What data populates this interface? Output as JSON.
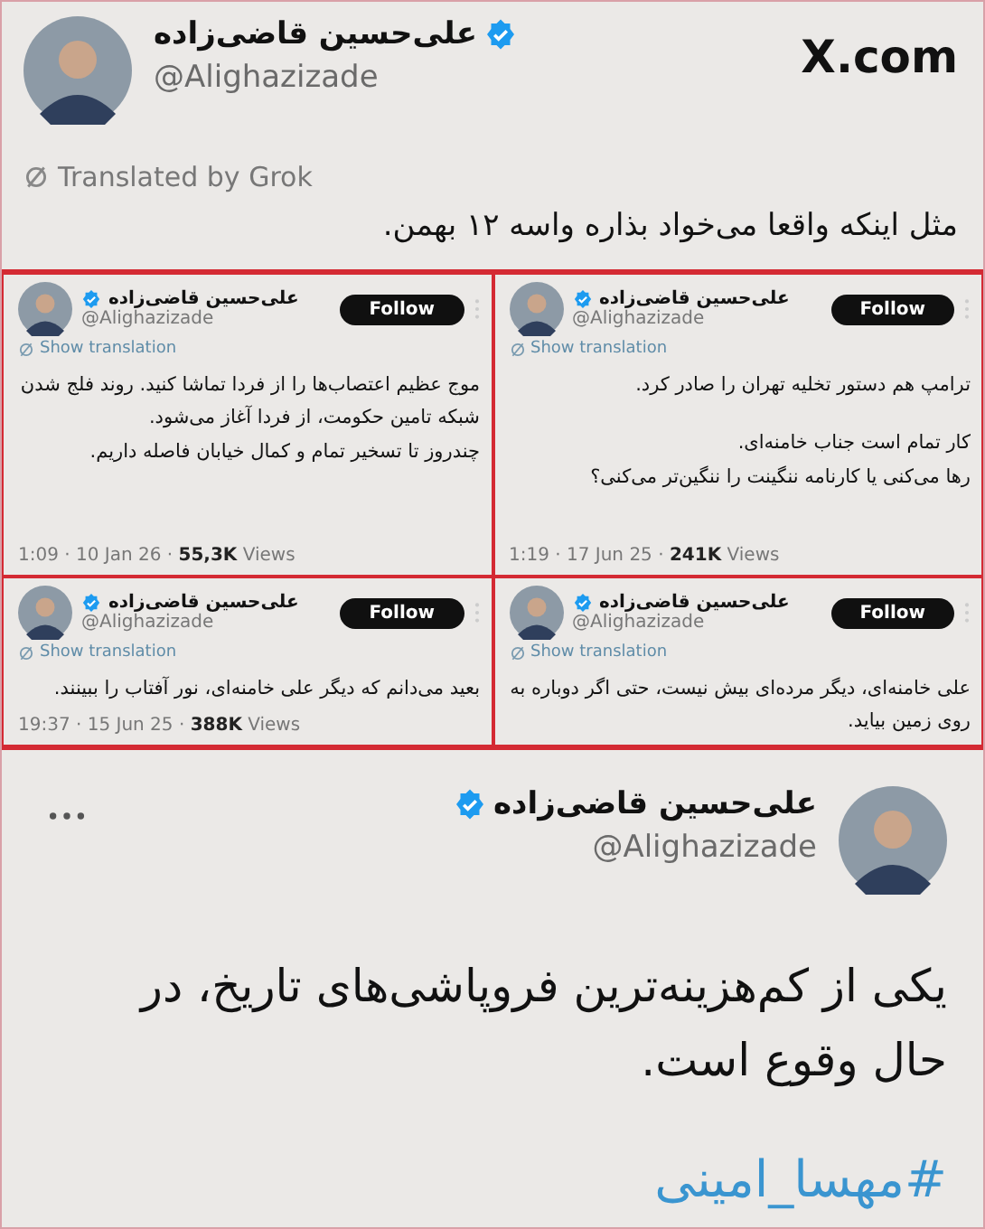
{
  "top_post": {
    "name": "علی‌حسین قاضی‌زاده",
    "verified": true,
    "handle": "@Alighazizade",
    "site": "X.com",
    "translated_by": "Translated by Grok",
    "text": "مثل اینکه واقعا می‌خواد بذاره واسه ۱۲ بهمن."
  },
  "grid_posts": [
    {
      "name": "علی‌حسین قاضی‌زاده",
      "verified": true,
      "handle": "@Alighazizade",
      "follow": "Follow",
      "show_translation": "Show translation",
      "paragraphs": [
        "ترامپ هم دستور تخلیه تهران را صادر کرد.",
        "کار تمام است جناب خامنه‌ای.\nرها می‌کنی یا کارنامه ننگینت را ننگین‌تر می‌کنی؟"
      ],
      "meta": "1:19 · 17 Jun 25 · **241K** Views"
    },
    {
      "name": "علی‌حسین قاضی‌زاده",
      "verified": true,
      "handle": "@Alighazizade",
      "follow": "Follow",
      "show_translation": "Show translation",
      "paragraphs": [
        "موج عظیم اعتصاب‌ها را از فردا تماشا کنید. روند فلج شدن شبکه تامین حکومت، از فردا آغاز می‌شود.\nچندروز تا تسخیر تمام و کمال خیابان فاصله داریم."
      ],
      "meta": "1:09 · 10 Jan 26 · **55,3K** Views"
    },
    {
      "name": "علی‌حسین قاضی‌زاده",
      "verified": true,
      "handle": "@Alighazizade",
      "follow": "Follow",
      "show_translation": "Show translation",
      "paragraphs": [
        "علی خامنه‌ای، دیگر مرده‌ای بیش نیست، حتی اگر دوباره به روی زمین بیاید."
      ]
    },
    {
      "name": "علی‌حسین قاضی‌زاده",
      "verified": true,
      "handle": "@Alighazizade",
      "follow": "Follow",
      "show_translation": "Show translation",
      "paragraphs": [
        "بعید می‌دانم که دیگر علی خامنه‌ای، نور آفتاب را ببینند."
      ],
      "meta": "19:37 · 15 Jun 25 · **388K** Views"
    }
  ],
  "bottom_post": {
    "name": "علی‌حسین قاضی‌زاده",
    "verified": true,
    "handle": "@Alighazizade",
    "text": "یکی از کم‌هزینه‌ترین فروپاشی‌های تاریخ، در حال وقوع است.",
    "hashtag": "#مهسا_امینی"
  }
}
